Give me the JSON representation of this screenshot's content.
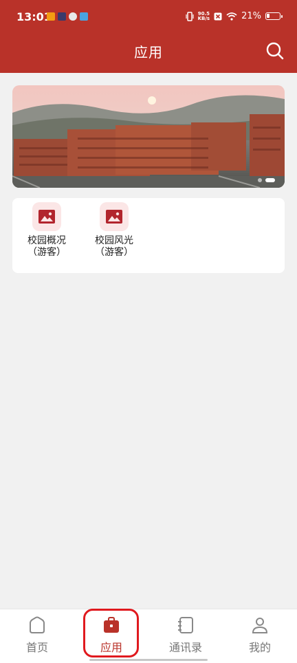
{
  "status_bar": {
    "time": "13:01",
    "net_speed_value": "90.5",
    "net_speed_unit": "KB/s",
    "battery_percent": "21%",
    "battery_level": 0.21
  },
  "header": {
    "title": "应用",
    "search_icon": "search-icon"
  },
  "banner": {
    "image": "campus-photo",
    "slide_count": 2,
    "active_slide": 2
  },
  "apps": [
    {
      "line1": "校园概况",
      "line2": "（游客）",
      "icon": "image-icon"
    },
    {
      "line1": "校园风光",
      "line2": "（游客）",
      "icon": "image-icon"
    }
  ],
  "tabbar": {
    "tabs": [
      {
        "label": "首页",
        "icon": "home-icon"
      },
      {
        "label": "应用",
        "icon": "briefcase-icon",
        "active": true
      },
      {
        "label": "通讯录",
        "icon": "contacts-book-icon"
      },
      {
        "label": "我的",
        "icon": "profile-icon"
      }
    ]
  },
  "colors": {
    "brand": "#b93229",
    "icon_bg": "#fbe6e6",
    "icon_fg": "#b2252d",
    "highlight": "#e0191e"
  }
}
